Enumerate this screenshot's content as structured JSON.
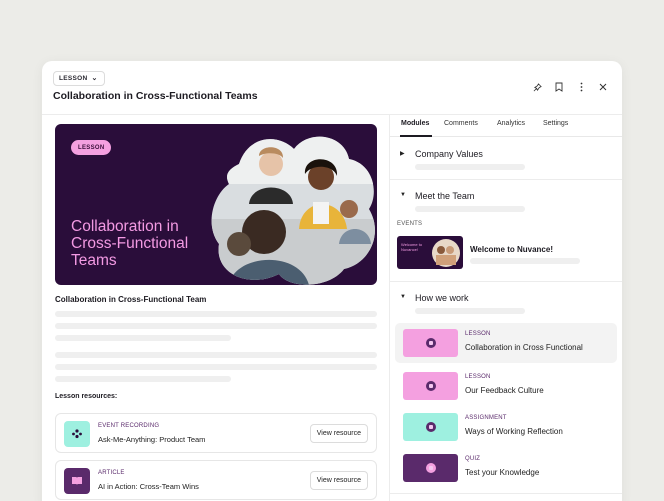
{
  "header": {
    "type_chip": "LESSON",
    "title": "Collaboration in Cross-Functional Teams",
    "icons": [
      "pin-icon",
      "bookmark-icon",
      "more-icon",
      "close-icon"
    ]
  },
  "hero": {
    "chip": "LESSON",
    "title": "Collaboration in Cross-Functional Teams"
  },
  "lesson": {
    "subtitle": "Collaboration in Cross-Functional Team"
  },
  "resources": {
    "heading": "Lesson resources:",
    "items": [
      {
        "kind": "EVENT RECORDING",
        "name": "Ask-Me-Anything: Product Team",
        "button": "View resource",
        "icon": "people-icon"
      },
      {
        "kind": "ARTICLE",
        "name": "AI in Action: Cross-Team Wins",
        "button": "View resource",
        "icon": "book-icon"
      }
    ]
  },
  "tabs": [
    "Modules",
    "Comments",
    "Analytics",
    "Settings"
  ],
  "modules": [
    {
      "title": "Company Values",
      "expanded": false
    },
    {
      "title": "Meet the Team",
      "expanded": true
    },
    {
      "title": "How we work",
      "expanded": true
    }
  ],
  "events": {
    "label": "EVENTS",
    "thumb_text": "Welcome to Nuvance!",
    "title": "Welcome to Nuvance!"
  },
  "lessons": [
    {
      "kind": "LESSON",
      "name": "Collaboration in Cross Functional",
      "color": "#f4a0e0"
    },
    {
      "kind": "LESSON",
      "name": "Our Feedback Culture",
      "color": "#f4a0e0"
    },
    {
      "kind": "ASSIGNMENT",
      "name": "Ways of Working Reflection",
      "color": "#9ef0e0"
    },
    {
      "kind": "QUIZ",
      "name": "Test your Knowledge",
      "color": "#5a2a6b"
    }
  ],
  "colors": {
    "brand_dark": "#2a0d3a",
    "brand_pink": "#f39ae3",
    "teal": "#9ef0e0"
  }
}
